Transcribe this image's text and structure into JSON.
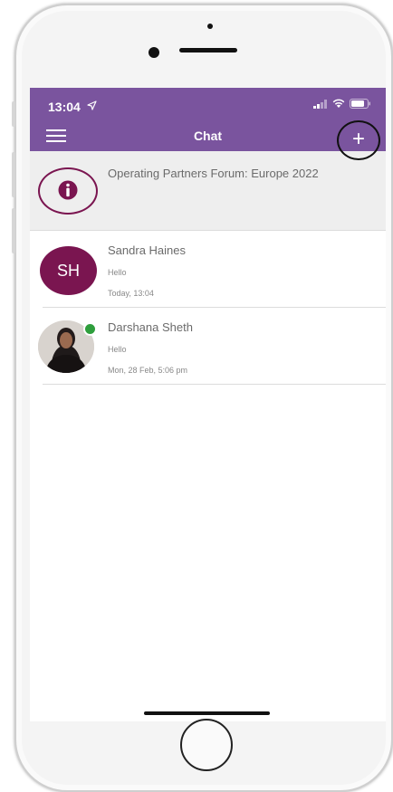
{
  "status_bar": {
    "time": "13:04"
  },
  "nav": {
    "title": "Chat",
    "add_label": "+"
  },
  "pinned": {
    "title": "Operating Partners Forum: Europe 2022"
  },
  "chats": [
    {
      "initials": "SH",
      "name": "Sandra Haines",
      "message": "Hello",
      "time": "Today, 13:04"
    },
    {
      "name": "Darshana Sheth",
      "message": "Hello",
      "time": "Mon, 28 Feb, 5:06 pm"
    }
  ],
  "colors": {
    "header": "#7a549e",
    "accent": "#7a1550",
    "online": "#2e9e3c"
  },
  "icons": [
    "location-arrow-icon",
    "signal-icon",
    "wifi-icon",
    "battery-icon",
    "menu-icon",
    "add-icon",
    "info-icon"
  ]
}
